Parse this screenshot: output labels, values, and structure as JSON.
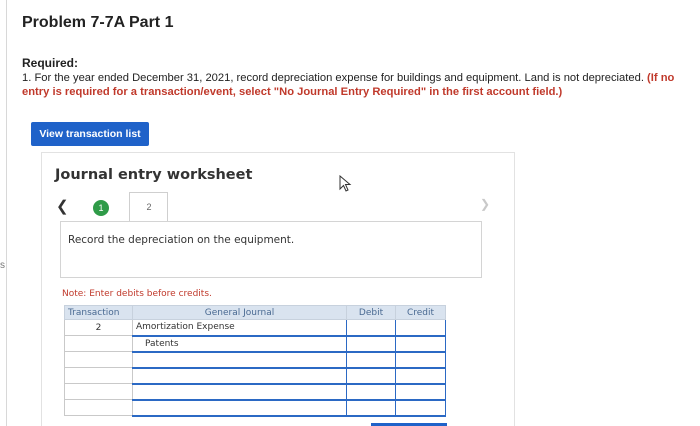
{
  "problem": {
    "title": "Problem 7-7A Part 1",
    "required_label": "Required:",
    "instruction_main": "1. For the year ended December 31, 2021, record depreciation expense for buildings and equipment. Land is not depreciated.",
    "instruction_note": "(If no entry is required for a transaction/event, select \"No Journal Entry Required\" in the first account field.)"
  },
  "left_gutter_mark": "s",
  "view_transaction_button": "View transaction list",
  "worksheet": {
    "title": "Journal entry worksheet",
    "steps": [
      "1",
      "2"
    ],
    "prev_icon": "chevron-left-icon",
    "next_icon": "chevron-right-icon",
    "prompt": "Record the depreciation on the equipment.",
    "note": "Note: Enter debits before credits."
  },
  "journal": {
    "headers": {
      "transaction": "Transaction",
      "general_journal": "General Journal",
      "debit": "Debit",
      "credit": "Credit"
    },
    "rows": [
      {
        "transaction": "2",
        "account": "Amortization Expense",
        "debit": "",
        "credit": ""
      },
      {
        "transaction": "",
        "account": "Patents",
        "debit": "",
        "credit": ""
      },
      {
        "transaction": "",
        "account": "",
        "debit": "",
        "credit": ""
      },
      {
        "transaction": "",
        "account": "",
        "debit": "",
        "credit": ""
      },
      {
        "transaction": "",
        "account": "",
        "debit": "",
        "credit": ""
      },
      {
        "transaction": "",
        "account": "",
        "debit": "",
        "credit": ""
      }
    ]
  },
  "colors": {
    "accent": "#1f62c9",
    "step_done": "#2f9b48",
    "note_red": "#c0392b",
    "header_bg": "#d9e3ef"
  }
}
